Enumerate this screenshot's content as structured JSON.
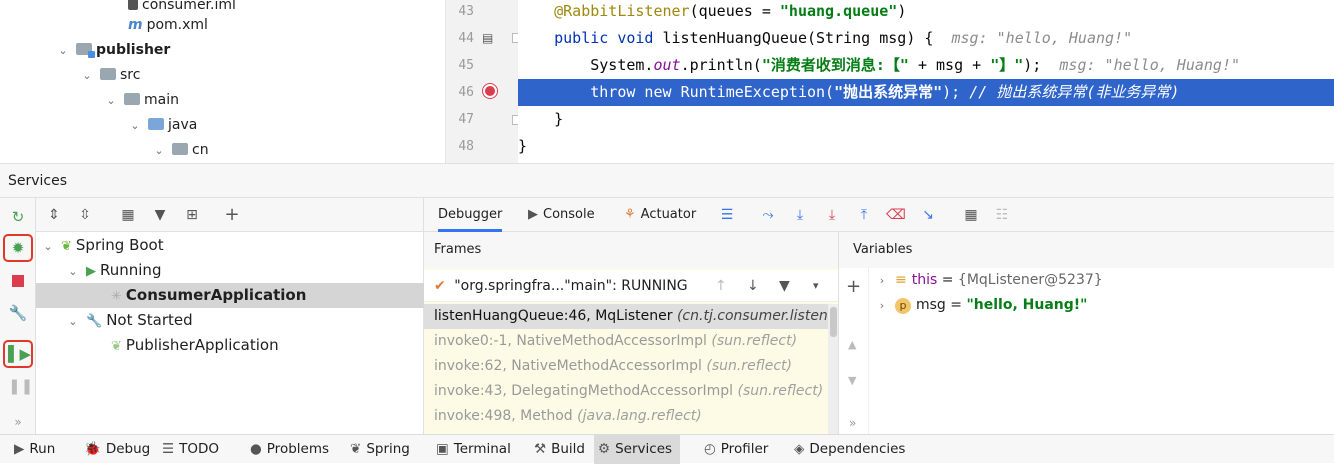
{
  "project_tree": [
    {
      "name": "consumer.iml",
      "kind": "file",
      "indent": 5
    },
    {
      "name": "pom.xml",
      "kind": "maven",
      "indent": 5
    },
    {
      "name": "publisher",
      "kind": "module",
      "indent": 2
    },
    {
      "name": "src",
      "kind": "folder",
      "indent": 3
    },
    {
      "name": "main",
      "kind": "folder",
      "indent": 4
    },
    {
      "name": "java",
      "kind": "source",
      "indent": 5
    },
    {
      "name": "cn",
      "kind": "package",
      "indent": 6
    }
  ],
  "editor": {
    "line_numbers": [
      "43",
      "44",
      "45",
      "46",
      "47",
      "48"
    ],
    "lines": [
      {
        "parts": [
          {
            "c": "ann",
            "t": "    @RabbitListener"
          },
          {
            "c": "",
            "t": "(queues = "
          },
          {
            "c": "str",
            "t": "\"huang.queue\""
          },
          {
            "c": "",
            "t": ")"
          }
        ]
      },
      {
        "parts": [
          {
            "c": "kw",
            "t": "    public void "
          },
          {
            "c": "",
            "t": "listenHuangQueue(String msg) {  "
          },
          {
            "c": "hint",
            "t": "msg: \"hello, Huang!\""
          }
        ]
      },
      {
        "parts": [
          {
            "c": "",
            "t": "        System."
          },
          {
            "c": "st",
            "t": "out"
          },
          {
            "c": "",
            "t": ".println("
          },
          {
            "c": "str",
            "t": "\"消费者收到消息:【\""
          },
          {
            "c": "",
            "t": " + msg + "
          },
          {
            "c": "str",
            "t": "\"】\""
          },
          {
            "c": "",
            "t": ");  "
          },
          {
            "c": "hint",
            "t": "msg: \"hello, Huang!\""
          }
        ]
      },
      {
        "selected": true,
        "parts": [
          {
            "c": "kw",
            "t": "        throw new "
          },
          {
            "c": "",
            "t": "RuntimeException("
          },
          {
            "c": "str",
            "t": "\"抛出系统异常\""
          },
          {
            "c": "",
            "t": "); "
          },
          {
            "c": "cm",
            "t": "// 抛出系统异常(非业务异常)"
          }
        ]
      },
      {
        "parts": [
          {
            "c": "",
            "t": "    }"
          }
        ]
      },
      {
        "parts": [
          {
            "c": "",
            "t": "}"
          }
        ]
      }
    ]
  },
  "services": {
    "title": "Services",
    "tree": [
      {
        "label": "Spring Boot",
        "indent": 1,
        "chevron": "v",
        "icon": "spring-boot-icon"
      },
      {
        "label": "Running",
        "indent": 2,
        "chevron": "v",
        "icon": "run-icon"
      },
      {
        "label": "ConsumerApplication",
        "indent": 3,
        "chevron": "",
        "icon": "loading-icon",
        "selected": true
      },
      {
        "label": "Not Started",
        "indent": 2,
        "chevron": "v",
        "icon": "wrench-icon"
      },
      {
        "label": "PublisherApplication",
        "indent": 3,
        "chevron": "",
        "icon": "spring-app-icon"
      }
    ]
  },
  "debugger": {
    "tabs": [
      {
        "label": "Debugger",
        "active": true
      },
      {
        "label": "Console"
      },
      {
        "label": "Actuator"
      }
    ],
    "frames_title": "Frames",
    "thread": "\"org.springfra...\"main\": RUNNING",
    "frames": [
      {
        "method": "listenHuangQueue:46, MqListener",
        "pkg": "(cn.tj.consumer.listener",
        "current": true
      },
      {
        "method": "invoke0:-1, NativeMethodAccessorImpl",
        "pkg": "(sun.reflect)"
      },
      {
        "method": "invoke:62, NativeMethodAccessorImpl",
        "pkg": "(sun.reflect)"
      },
      {
        "method": "invoke:43, DelegatingMethodAccessorImpl",
        "pkg": "(sun.reflect)"
      },
      {
        "method": "invoke:498, Method",
        "pkg": "(java.lang.reflect)"
      }
    ],
    "variables_title": "Variables",
    "variables": [
      {
        "name": "this",
        "eq": " = ",
        "value": "{MqListener@5237}",
        "icon": "field-icon"
      },
      {
        "name": "msg",
        "eq": " = ",
        "value": "\"hello, Huang!\"",
        "icon": "param-icon"
      }
    ]
  },
  "bottom_bar": [
    {
      "label": "Run",
      "icon": "▶"
    },
    {
      "label": "Debug",
      "icon": "🐞"
    },
    {
      "label": "TODO",
      "icon": "☰"
    },
    {
      "label": "Problems",
      "icon": "●"
    },
    {
      "label": "Spring",
      "icon": "❦"
    },
    {
      "label": "Terminal",
      "icon": "▣"
    },
    {
      "label": "Build",
      "icon": "⚒"
    },
    {
      "label": "Services",
      "icon": "⚙",
      "active": true
    },
    {
      "label": "Profiler",
      "icon": "◴"
    },
    {
      "label": "Dependencies",
      "icon": "◈"
    }
  ]
}
